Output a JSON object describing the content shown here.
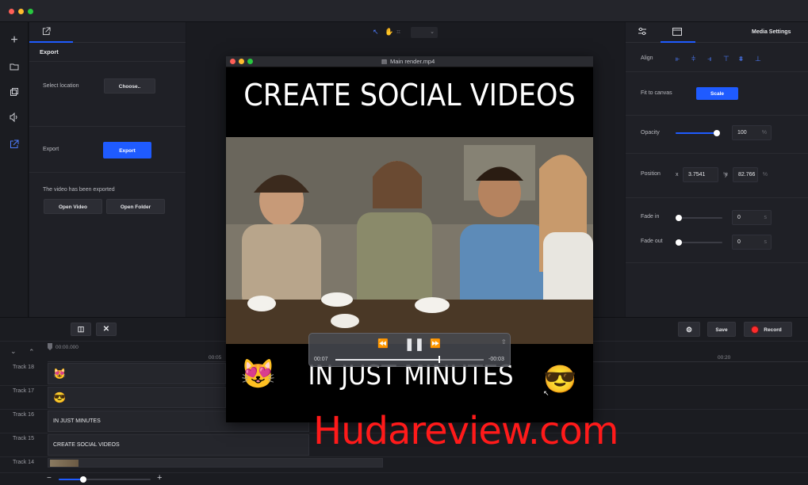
{
  "left_panel": {
    "header_icon": "export-icon",
    "title": "Export",
    "select_location_label": "Select location",
    "choose_button": "Choose..",
    "export_label": "Export",
    "export_button": "Export",
    "exported_message": "The video has been exported",
    "open_video_button": "Open Video",
    "open_folder_button": "Open Folder"
  },
  "right_panel": {
    "tab_title": "Media Settings",
    "align_label": "Align",
    "fit_label": "Fit to canvas",
    "scale_button": "Scale",
    "opacity_label": "Opacity",
    "opacity_value": "100",
    "opacity_unit": "%",
    "opacity_fraction": 1.0,
    "position_label": "Position",
    "pos_x_label": "x",
    "pos_x_value": "3.7541",
    "pos_x_unit": "%",
    "pos_y_label": "y",
    "pos_y_value": "82.766",
    "pos_y_unit": "%",
    "fade_in_label": "Fade in",
    "fade_in_value": "0",
    "fade_in_unit": "s",
    "fade_out_label": "Fade out",
    "fade_out_value": "0",
    "fade_out_unit": "s"
  },
  "video_window": {
    "title": "Main render.mp4",
    "headline": "CREATE SOCIAL VIDEOS",
    "subline": "IN JUST MINUTES",
    "emoji_left": "😻",
    "emoji_right": "😎",
    "player": {
      "elapsed": "00:07",
      "remaining": "-00:03",
      "progress_fraction": 0.7
    }
  },
  "timeline": {
    "save_button": "Save",
    "record_button": "Record",
    "time_start": "00:00.000",
    "tick_05": "00:05",
    "tick_20": "00:20",
    "zoom_fraction": 0.27,
    "tracks": [
      {
        "label": "Track 18",
        "clip": "😻"
      },
      {
        "label": "Track 17",
        "clip": "😎"
      },
      {
        "label": "Track 16",
        "clip": "IN JUST MINUTES"
      },
      {
        "label": "Track 15",
        "clip": "CREATE SOCIAL VIDEOS"
      },
      {
        "label": "Track 14",
        "clip": ""
      }
    ]
  },
  "watermark": "Hudareview.com",
  "colors": {
    "accent": "#1f5bff",
    "record": "#ff2b2b",
    "watermark": "#ff1a1a"
  }
}
